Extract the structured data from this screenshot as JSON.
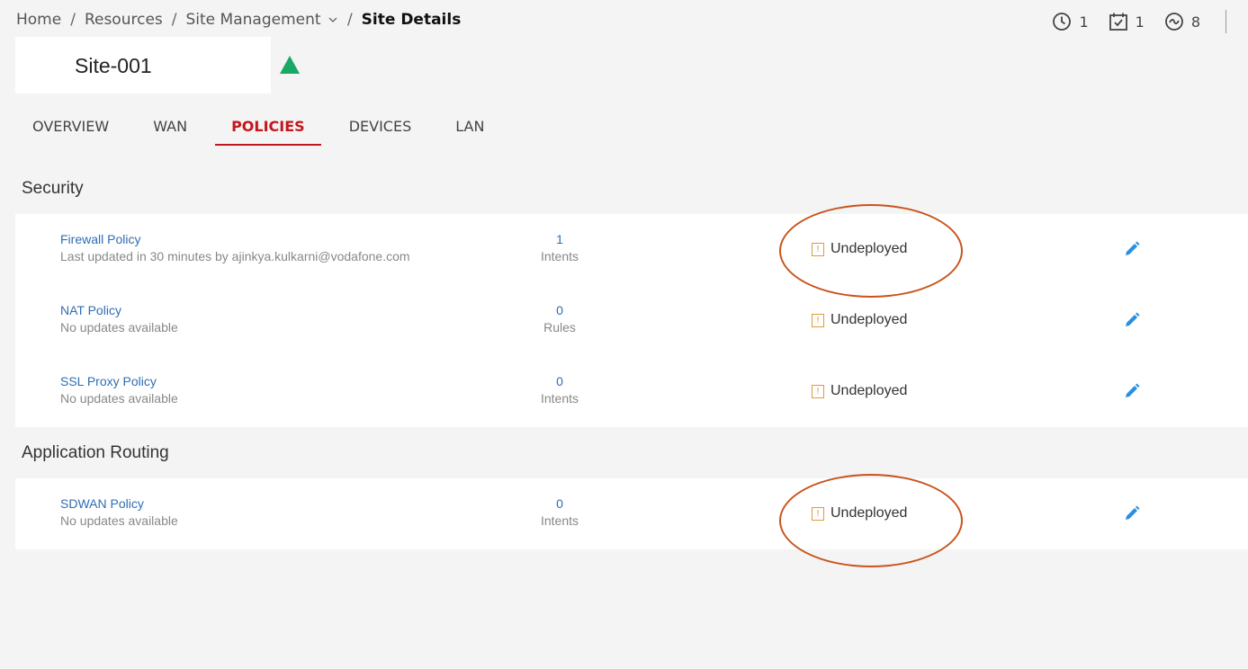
{
  "breadcrumb": {
    "home": "Home",
    "resources": "Resources",
    "site_management": "Site Management",
    "current": "Site Details",
    "separator": "/"
  },
  "counters": {
    "history": {
      "icon": "clock-icon",
      "count": "1"
    },
    "tasks": {
      "icon": "calendar-check-icon",
      "count": "1"
    },
    "activity": {
      "icon": "wave-circle-icon",
      "count": "8"
    }
  },
  "site": {
    "name": "Site-001",
    "status_icon": "triangle-up-icon",
    "status_color": "#1aa866"
  },
  "tabs": [
    {
      "label": "OVERVIEW",
      "active": false
    },
    {
      "label": "WAN",
      "active": false
    },
    {
      "label": "POLICIES",
      "active": true
    },
    {
      "label": "DEVICES",
      "active": false
    },
    {
      "label": "LAN",
      "active": false
    }
  ],
  "security": {
    "title": "Security",
    "rows": [
      {
        "name": "Firewall Policy",
        "subtitle": "Last updated in 30 minutes by ajinkya.kulkarni@vodafone.com",
        "count": "1",
        "count_label": "Intents",
        "status": "Undeployed"
      },
      {
        "name": "NAT Policy",
        "subtitle": "No updates available",
        "count": "0",
        "count_label": "Rules",
        "status": "Undeployed"
      },
      {
        "name": "SSL Proxy Policy",
        "subtitle": "No updates available",
        "count": "0",
        "count_label": "Intents",
        "status": "Undeployed"
      }
    ]
  },
  "routing": {
    "title": "Application Routing",
    "rows": [
      {
        "name": "SDWAN Policy",
        "subtitle": "No updates available",
        "count": "0",
        "count_label": "Intents",
        "status": "Undeployed"
      }
    ]
  },
  "colors": {
    "accent": "#c4161c",
    "link": "#2f6db5",
    "warning": "#e09a3a",
    "edit": "#2a8fe0",
    "annotation": "#c8541c"
  }
}
